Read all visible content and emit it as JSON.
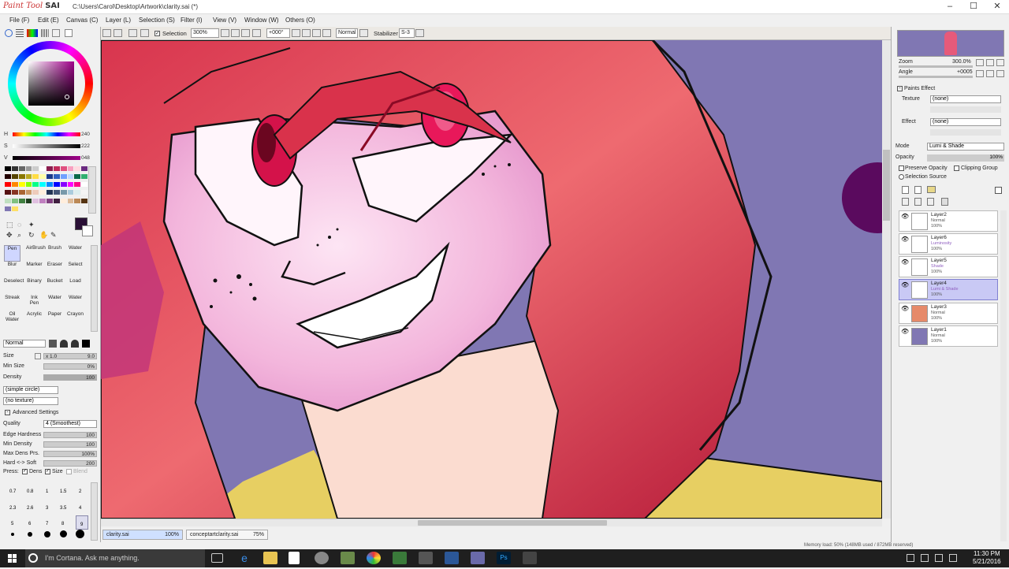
{
  "titlebar": {
    "logo_small": "Paint Tool",
    "logo_big": "SAI",
    "path": "C:\\Users\\Carol\\Desktop\\Artwork\\clarity.sai (*)",
    "min": "–",
    "max": "☐",
    "close": "✕"
  },
  "menu": [
    "File (F)",
    "Edit (E)",
    "Canvas (C)",
    "Layer (L)",
    "Selection (S)",
    "Filter (I)",
    "View (V)",
    "Window (W)",
    "Others (O)"
  ],
  "toolbar": {
    "selection_label": "Selection",
    "zoom": "300%",
    "angle": "+000°",
    "blend": "Normal",
    "stabilizer_label": "Stabilizer",
    "stabilizer": "S-3"
  },
  "color": {
    "h_label": "H",
    "h_val": "240",
    "s_label": "S",
    "s_val": "222",
    "v_label": "V",
    "v_val": "048",
    "current": "#2a1036"
  },
  "swatch_colors": [
    "#000",
    "#333",
    "#666",
    "#999",
    "#ccc",
    "#fff",
    "#8a1c4d",
    "#c02a5a",
    "#e05080",
    "#f9a0c0",
    "#ffd9e0",
    "#6a2a80",
    "#200",
    "#540",
    "#870",
    "#ba2",
    "#fd4",
    "#ffa",
    "#1a3a8a",
    "#3060c0",
    "#70a0ff",
    "#c0d8ff",
    "#0a6a4a",
    "#30b070",
    "#f00",
    "#f80",
    "#ff0",
    "#8f0",
    "#0f8",
    "#0ff",
    "#08f",
    "#00f",
    "#80f",
    "#f0f",
    "#f08",
    "#fff",
    "#511",
    "#832",
    "#a63",
    "#c96",
    "#ecb",
    "#fed",
    "#235",
    "#457",
    "#79a",
    "#acd",
    "#dee",
    "#f5f5f5",
    "#c0e0c0",
    "#80c080",
    "#408040",
    "#204020",
    "#e0c0e0",
    "#c080c0",
    "#804080",
    "#402040",
    "#ffeedd",
    "#ddbb99",
    "#bb8855",
    "#553311",
    "#8077b3",
    "#ffe066"
  ],
  "tools": [
    "Pen",
    "AirBrush",
    "Brush",
    "Water",
    "Blur",
    "Marker",
    "Eraser",
    "Select",
    "Deselect",
    "Binary",
    "Bucket",
    "Load",
    "Streak",
    "Ink Pen",
    "Water",
    "Water",
    "Oil Water",
    "Acrylic",
    "Paper",
    "Crayon"
  ],
  "props": {
    "mode": "Normal",
    "size_label": "Size",
    "size_mult": "x 1.0",
    "size": "9.0",
    "minsize_label": "Min Size",
    "minsize": "0%",
    "density_label": "Density",
    "density": "100",
    "shape": "(simple circle)",
    "texture": "(no texture)",
    "advanced": "Advanced Settings",
    "quality_label": "Quality",
    "quality": "4 (Smoothest)",
    "edge_label": "Edge Hardness",
    "edge": "100",
    "mindens_label": "Min Density",
    "mindens": "100",
    "maxdens_label": "Max Dens Prs.",
    "maxdens": "100%",
    "hardsoft_label": "Hard <-> Soft",
    "hardsoft": "200",
    "press_label": "Press:",
    "press_dens": "Dens",
    "press_size": "Size",
    "press_blend": "Blend"
  },
  "brush_sizes": [
    "0.7",
    "0.8",
    "1",
    "1.5",
    "2",
    "2.3",
    "2.6",
    "3",
    "3.5",
    "4",
    "5",
    "6",
    "7",
    "8",
    "9"
  ],
  "doctabs": [
    {
      "name": "clarity.sai",
      "zoom": "100%"
    },
    {
      "name": "conceptartclarity.sai",
      "zoom": "75%"
    }
  ],
  "navigator": {
    "zoom_label": "Zoom",
    "zoom": "300.0%",
    "angle_label": "Angle",
    "angle": "+0005"
  },
  "paints": {
    "title": "Paints Effect",
    "texture_label": "Texture",
    "texture": "(none)",
    "effect_label": "Effect",
    "effect": "(none)"
  },
  "layerprops": {
    "mode_label": "Mode",
    "mode": "Lumi & Shade",
    "opacity_label": "Opacity",
    "opacity": "100%",
    "preserve": "Preserve Opacity",
    "clipping": "Clipping Group",
    "selsource": "Selection Source"
  },
  "layers": [
    {
      "name": "Layer2",
      "mode": "Normal",
      "opacity": "100%"
    },
    {
      "name": "Layer6",
      "mode": "Luminosity",
      "opacity": "100%"
    },
    {
      "name": "Layer5",
      "mode": "Shade",
      "opacity": "100%"
    },
    {
      "name": "Layer4",
      "mode": "Lumi & Shade",
      "opacity": "100%",
      "selected": true
    },
    {
      "name": "Layer3",
      "mode": "Normal",
      "opacity": "100%"
    },
    {
      "name": "Layer1",
      "mode": "Normal",
      "opacity": "100%"
    }
  ],
  "status": "Memory load: 50% (148MB used / 872MB reserved)",
  "taskbar": {
    "cortana": "I'm Cortana. Ask me anything.",
    "time": "11:30 PM",
    "date": "5/21/2016"
  }
}
